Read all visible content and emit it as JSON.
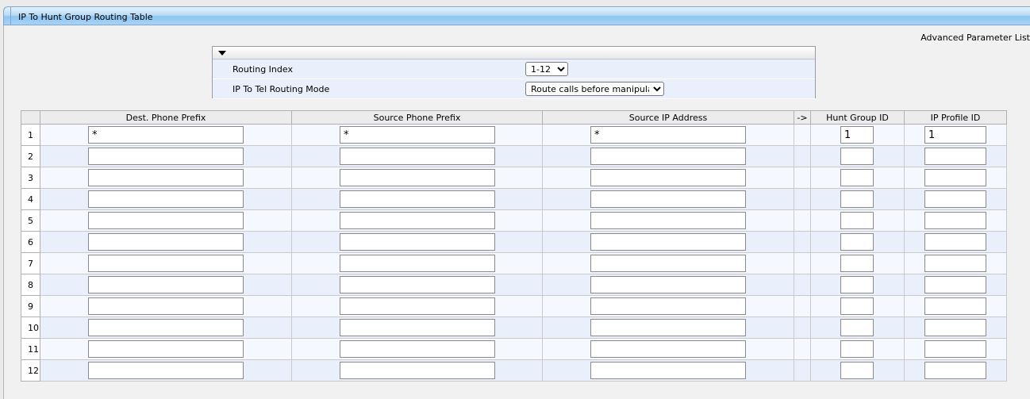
{
  "window": {
    "title": "IP To Hunt Group Routing Table"
  },
  "advanced_link": "Advanced Parameter List",
  "params": {
    "routing_index": {
      "label": "Routing Index",
      "value": "1-12"
    },
    "routing_mode": {
      "label": "IP To Tel Routing Mode",
      "value": "Route calls before manipulation"
    }
  },
  "table": {
    "headers": {
      "dest": "Dest. Phone Prefix",
      "src_phone": "Source Phone Prefix",
      "src_ip": "Source IP Address",
      "arrow": "->",
      "hunt": "Hunt Group ID",
      "profile": "IP Profile ID"
    },
    "rows": [
      {
        "idx": "1",
        "dest": "*",
        "src_phone": "*",
        "src_ip": "*",
        "hunt": "1",
        "profile": "1"
      },
      {
        "idx": "2",
        "dest": "",
        "src_phone": "",
        "src_ip": "",
        "hunt": "",
        "profile": ""
      },
      {
        "idx": "3",
        "dest": "",
        "src_phone": "",
        "src_ip": "",
        "hunt": "",
        "profile": ""
      },
      {
        "idx": "4",
        "dest": "",
        "src_phone": "",
        "src_ip": "",
        "hunt": "",
        "profile": ""
      },
      {
        "idx": "5",
        "dest": "",
        "src_phone": "",
        "src_ip": "",
        "hunt": "",
        "profile": ""
      },
      {
        "idx": "6",
        "dest": "",
        "src_phone": "",
        "src_ip": "",
        "hunt": "",
        "profile": ""
      },
      {
        "idx": "7",
        "dest": "",
        "src_phone": "",
        "src_ip": "",
        "hunt": "",
        "profile": ""
      },
      {
        "idx": "8",
        "dest": "",
        "src_phone": "",
        "src_ip": "",
        "hunt": "",
        "profile": ""
      },
      {
        "idx": "9",
        "dest": "",
        "src_phone": "",
        "src_ip": "",
        "hunt": "",
        "profile": ""
      },
      {
        "idx": "10",
        "dest": "",
        "src_phone": "",
        "src_ip": "",
        "hunt": "",
        "profile": ""
      },
      {
        "idx": "11",
        "dest": "",
        "src_phone": "",
        "src_ip": "",
        "hunt": "",
        "profile": ""
      },
      {
        "idx": "12",
        "dest": "",
        "src_phone": "",
        "src_ip": "",
        "hunt": "",
        "profile": ""
      }
    ]
  }
}
